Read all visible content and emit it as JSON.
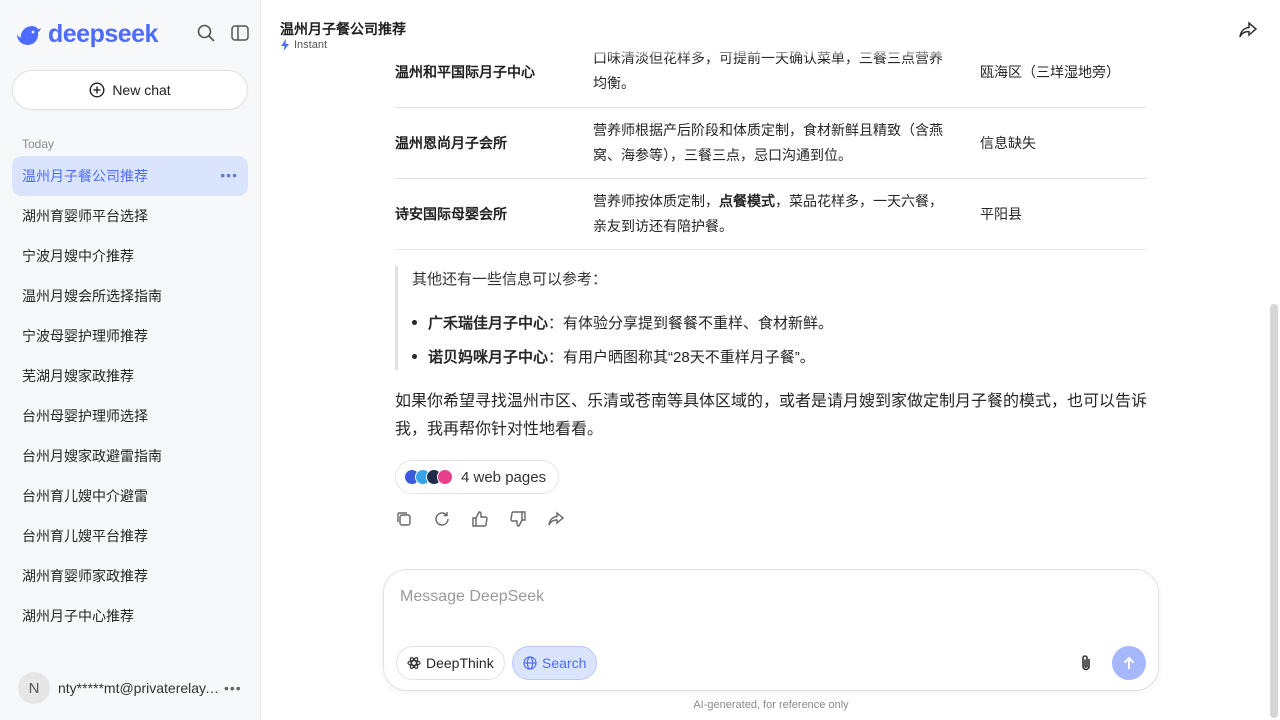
{
  "sidebar": {
    "brand": "deepseek",
    "new_chat_label": "New chat",
    "section_today": "Today",
    "items": [
      {
        "label": "温州月子餐公司推荐"
      },
      {
        "label": "湖州育婴师平台选择"
      },
      {
        "label": "宁波月嫂中介推荐"
      },
      {
        "label": "温州月嫂会所选择指南"
      },
      {
        "label": "宁波母婴护理师推荐"
      },
      {
        "label": "芜湖月嫂家政推荐"
      },
      {
        "label": "台州母婴护理师选择"
      },
      {
        "label": "台州月嫂家政避雷指南"
      },
      {
        "label": "台州育儿嫂中介避雷"
      },
      {
        "label": "台州育儿嫂平台推荐"
      },
      {
        "label": "湖州育婴师家政推荐"
      },
      {
        "label": "湖州月子中心推荐"
      }
    ],
    "user": {
      "initial": "N",
      "email": "nty*****mt@privaterelay.appleid.com"
    }
  },
  "header": {
    "title": "温州月子餐公司推荐",
    "mode": "Instant"
  },
  "table": {
    "rows": [
      {
        "name": "温州和平国际月子中心",
        "desc": "口味清淡但花样多，可提前一天确认菜单，三餐三点营养均衡。",
        "location": "瓯海区（三垟湿地旁）"
      },
      {
        "name": "温州恩尚月子会所",
        "desc": "营养师根据产后阶段和体质定制，食材新鲜且精致（含燕窝、海参等），三餐三点，忌口沟通到位。",
        "location": "信息缺失"
      },
      {
        "name": "诗安国际母婴会所",
        "desc_pre": "营养师按体质定制，",
        "desc_bold": "点餐模式",
        "desc_post": "，菜品花样多，一天六餐，亲友到访还有陪护餐。",
        "location": "平阳县"
      }
    ]
  },
  "quote": {
    "intro": "其他还有一些信息可以参考：",
    "bullets": [
      {
        "bold": "广禾瑞佳月子中心",
        "text": "：有体验分享提到餐餐不重样、食材新鲜。"
      },
      {
        "bold": "诺贝妈咪月子中心",
        "text": "：有用户晒图称其“28天不重样月子餐”。"
      }
    ]
  },
  "closing": "如果你希望寻找温州市区、乐清或苍南等具体区域的，或者是请月嫂到家做定制月子餐的模式，也可以告诉我，我再帮你针对性地看看。",
  "sources": {
    "label": "4 web pages"
  },
  "composer": {
    "placeholder": "Message DeepSeek",
    "deepthink_label": "DeepThink",
    "search_label": "Search"
  },
  "disclaimer": "AI-generated, for reference only",
  "colors": {
    "accent": "#4d6bfe",
    "accent_soft": "#dbe4fd",
    "send_disabled": "#a7b7fb"
  }
}
